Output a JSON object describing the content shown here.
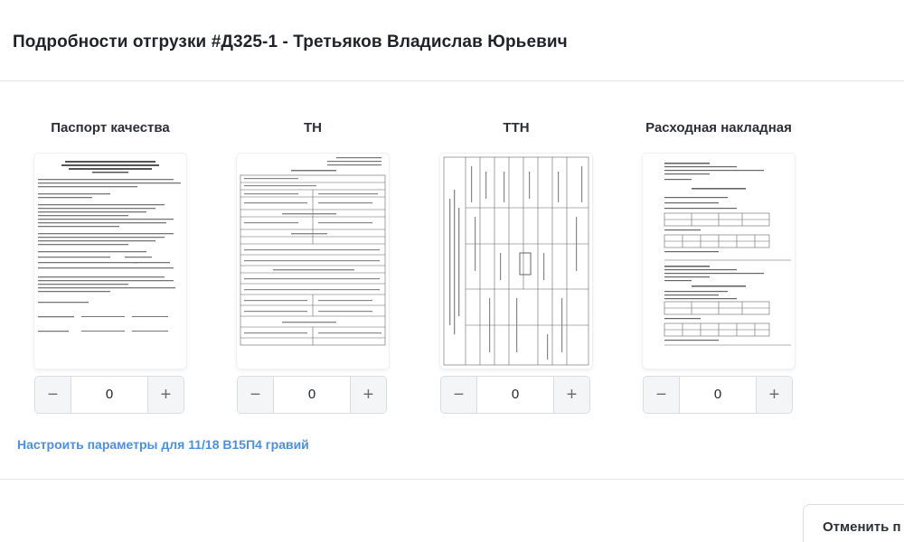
{
  "header": {
    "title": "Подробности отгрузки #Д325-1 - Третьяков Владислав Юрьевич"
  },
  "documents": [
    {
      "label": "Паспорт качества",
      "quantity": "0",
      "preview_icon": "quality-passport-document"
    },
    {
      "label": "ТН",
      "quantity": "0",
      "preview_icon": "waybill-document"
    },
    {
      "label": "ТТН",
      "quantity": "0",
      "preview_icon": "transport-waybill-document"
    },
    {
      "label": "Расходная накладная",
      "quantity": "0",
      "preview_icon": "expense-invoice-document"
    }
  ],
  "stepper": {
    "minus_symbol": "−",
    "plus_symbol": "+"
  },
  "config_link": "Настроить параметры для 11/18 В15П4 гравий",
  "footer": {
    "cancel_label": "Отменить п"
  },
  "colors": {
    "link": "#4a90e2",
    "border": "#d9dce1",
    "stepper_bg": "#f4f5f7"
  }
}
